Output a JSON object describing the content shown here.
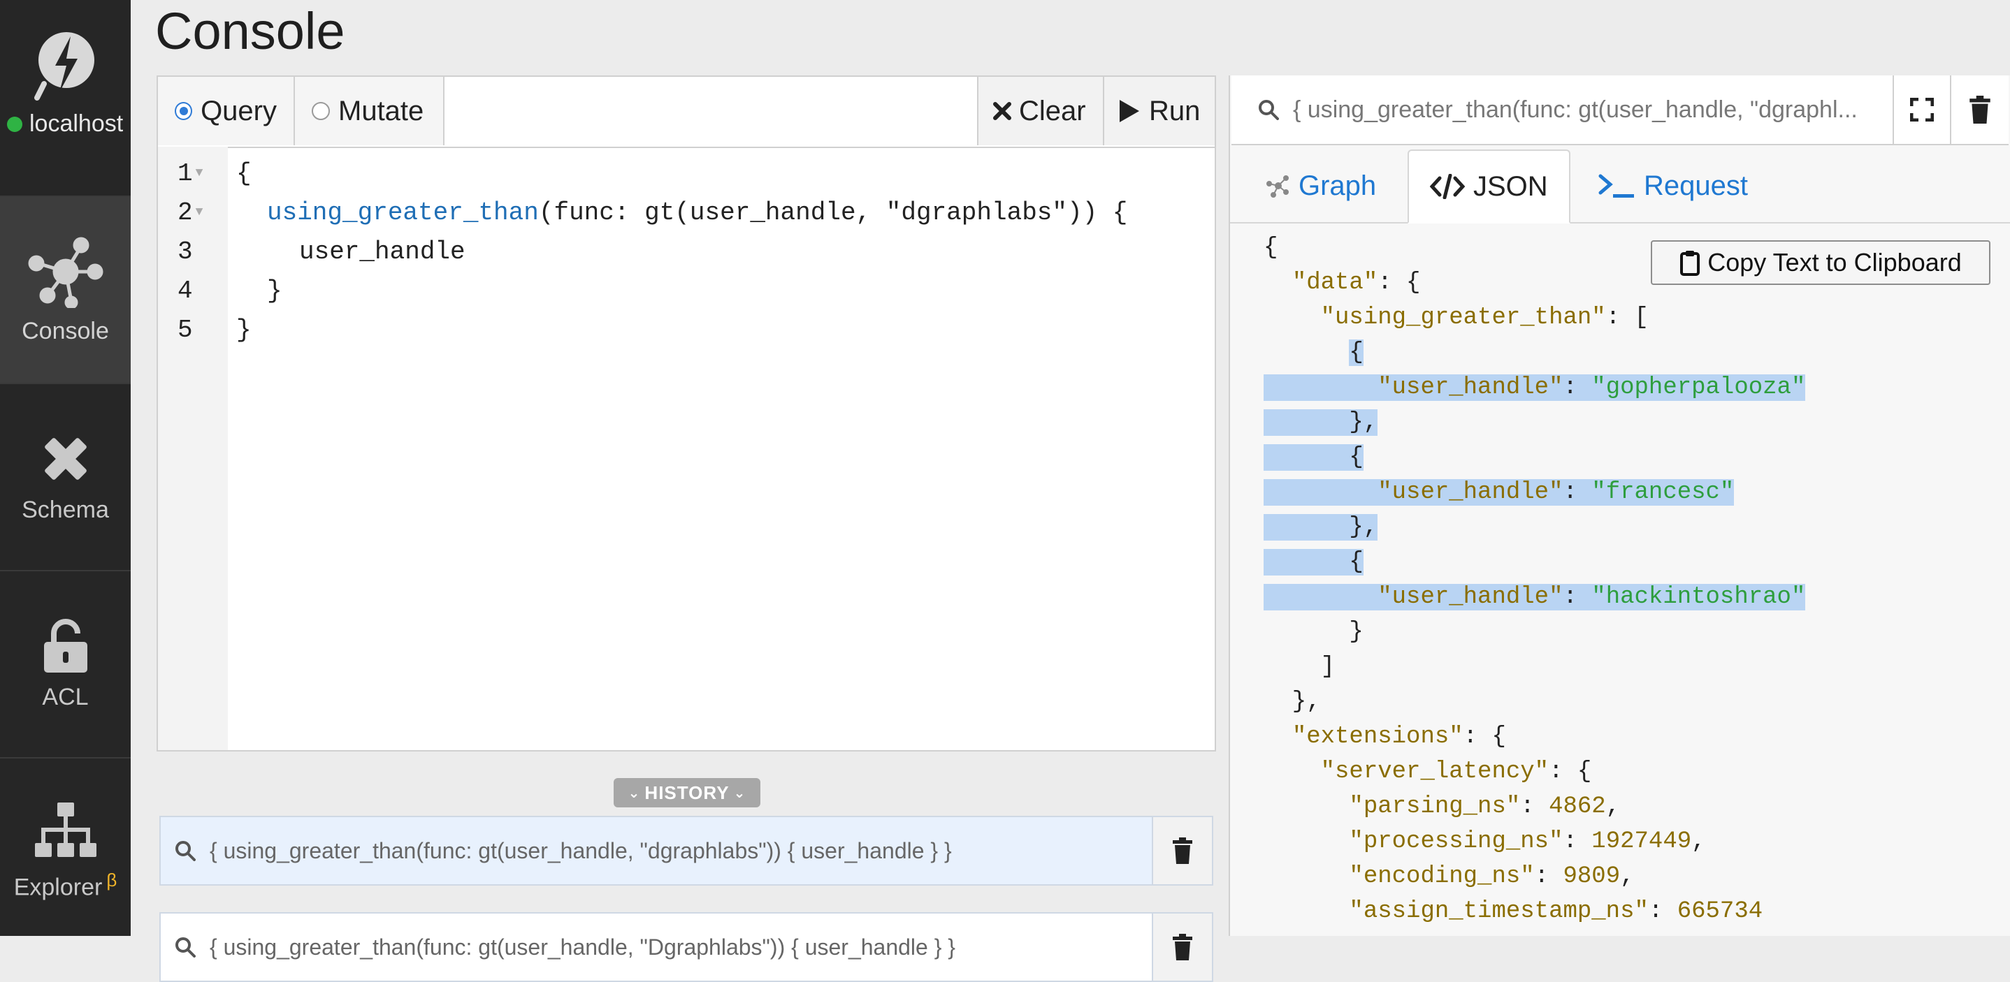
{
  "sidebar": {
    "host": "localhost",
    "items": [
      {
        "label": "Console",
        "icon": "console-icon"
      },
      {
        "label": "Schema",
        "icon": "schema-icon"
      },
      {
        "label": "ACL",
        "icon": "lock-icon"
      },
      {
        "label": "Explorer",
        "icon": "explorer-icon",
        "badge": "β"
      }
    ]
  },
  "header": {
    "title": "Console"
  },
  "editor": {
    "mode_query": "Query",
    "mode_mutate": "Mutate",
    "clear_label": "Clear",
    "run_label": "Run",
    "line_numbers": [
      "1",
      "2",
      "3",
      "4",
      "5"
    ],
    "lines": {
      "l1": "{",
      "l2_fn": "using_greater_than",
      "l2_rest": "(func: gt(user_handle, \"dgraphlabs\")) {",
      "l3": "user_handle",
      "l4": "}",
      "l5": "}"
    }
  },
  "history": {
    "toggle_label": "HISTORY",
    "items": [
      {
        "query": "{ using_greater_than(func: gt(user_handle, \"dgraphlabs\")) { user_handle } }"
      },
      {
        "query": "{ using_greater_than(func: gt(user_handle, \"Dgraphlabs\")) { user_handle } }"
      }
    ]
  },
  "result": {
    "query_preview": "{ using_greater_than(func: gt(user_handle, \"dgraphl...",
    "tabs": {
      "graph": "Graph",
      "json": "JSON",
      "request": "Request"
    },
    "copy_label": "Copy Text to Clipboard",
    "json": {
      "data_key": "\"data\"",
      "ugt_key": "\"using_greater_than\"",
      "user_handle_key": "\"user_handle\"",
      "users": [
        "\"gopherpalooza\"",
        "\"francesc\"",
        "\"hackintoshrao\""
      ],
      "extensions_key": "\"extensions\"",
      "server_latency_key": "\"server_latency\"",
      "parsing_ns_key": "\"parsing_ns\"",
      "parsing_ns": "4862",
      "processing_ns_key": "\"processing_ns\"",
      "processing_ns": "1927449",
      "encoding_ns_key": "\"encoding_ns\"",
      "encoding_ns": "9809",
      "assign_timestamp_ns_key": "\"assign_timestamp_ns\"",
      "assign_timestamp_ns": "665734"
    }
  }
}
